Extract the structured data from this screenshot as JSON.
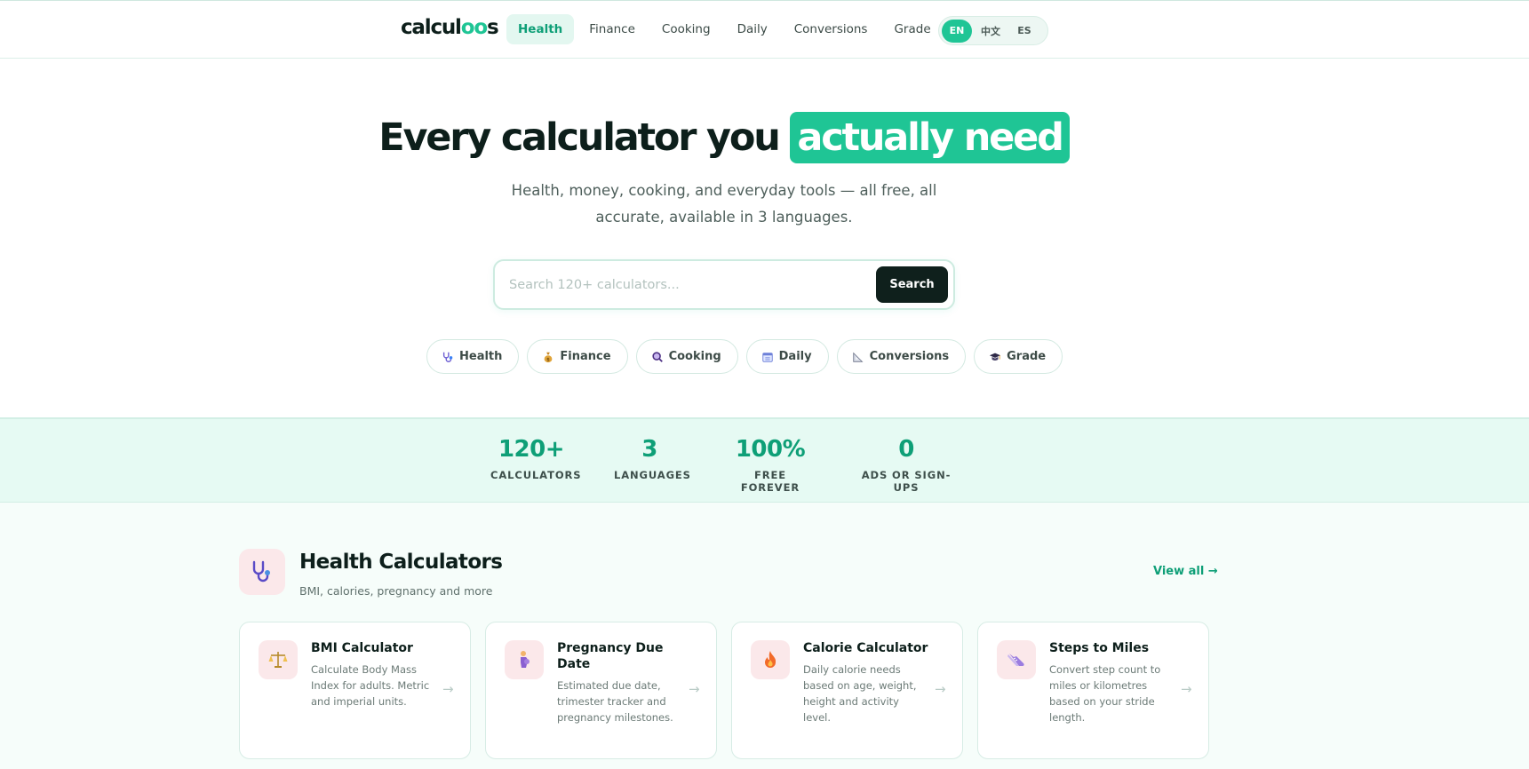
{
  "nav": {
    "logo_main": "calcul",
    "logo_accent": "oo",
    "logo_end": "s",
    "links": [
      "Health",
      "Finance",
      "Cooking",
      "Daily",
      "Conversions",
      "Grade"
    ],
    "active_link": "Health",
    "languages": [
      "EN",
      "中文",
      "ES"
    ],
    "active_language": "EN"
  },
  "hero": {
    "title_plain": "Every calculator you",
    "title_highlight": "actually need",
    "subtitle": "Health, money, cooking, and everyday tools — all free, all accurate, available in 3 languages.",
    "search_placeholder": "Search 120+ calculators...",
    "search_button": "Search",
    "chips": [
      {
        "label": "Health",
        "icon": "stethoscope-icon"
      },
      {
        "label": "Finance",
        "icon": "money-bag-icon"
      },
      {
        "label": "Cooking",
        "icon": "magnifier-icon"
      },
      {
        "label": "Daily",
        "icon": "calendar-icon"
      },
      {
        "label": "Conversions",
        "icon": "ruler-triangle-icon"
      },
      {
        "label": "Grade",
        "icon": "graduation-cap-icon"
      }
    ]
  },
  "stats": [
    {
      "value": "120+",
      "label": "CALCULATORS"
    },
    {
      "value": "3",
      "label": "LANGUAGES"
    },
    {
      "value": "100%",
      "label": "FREE FOREVER"
    },
    {
      "value": "0",
      "label": "ADS OR SIGN-UPS"
    }
  ],
  "section": {
    "title": "Health Calculators",
    "subtitle": "BMI, calories, pregnancy and more",
    "view_all": "View all →",
    "icon": "stethoscope-icon",
    "cards": [
      {
        "title": "BMI Calculator",
        "desc": "Calculate Body Mass Index for adults. Metric and imperial units.",
        "icon": "scales-icon"
      },
      {
        "title": "Pregnancy Due Date",
        "desc": "Estimated due date, trimester tracker and pregnancy milestones.",
        "icon": "pregnant-person-icon"
      },
      {
        "title": "Calorie Calculator",
        "desc": "Daily calorie needs based on age, weight, height and activity level.",
        "icon": "flame-icon"
      },
      {
        "title": "Steps to Miles",
        "desc": "Convert step count to miles or kilometres based on your stride length.",
        "icon": "sneaker-icon"
      }
    ],
    "card_arrow": "→"
  },
  "colors": {
    "accent": "#1fc595",
    "accent_dark": "#0e9f77",
    "dark": "#0f201c",
    "stats_bg": "#e6faf3",
    "icon_bg": "#fbe8ea"
  }
}
